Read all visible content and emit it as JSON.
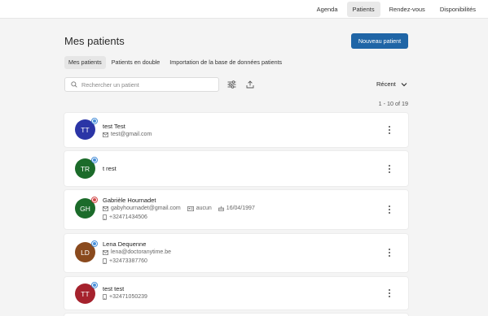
{
  "topnav": {
    "items": [
      {
        "label": "Agenda"
      },
      {
        "label": "Patients"
      },
      {
        "label": "Rendez-vous"
      },
      {
        "label": "Disponibilités"
      }
    ],
    "active": "Patients"
  },
  "page": {
    "title": "Mes patients",
    "new_button": "Nouveau patient"
  },
  "tabs": [
    {
      "label": "Mes patients",
      "active": true
    },
    {
      "label": "Patients en double",
      "active": false
    },
    {
      "label": "Importation de la base de données patients",
      "active": false
    }
  ],
  "search": {
    "placeholder": "Rechercher un patient",
    "value": ""
  },
  "toolbar": {
    "filter_icon": "sliders-icon",
    "export_icon": "upload-icon"
  },
  "sort": {
    "label": "Récent"
  },
  "pagination": {
    "text": "1 - 10 of 19"
  },
  "colors": {
    "primary": "#1f65a6",
    "badge_blue": "#4a90d9",
    "badge_red": "#d34a4a"
  },
  "patients": [
    {
      "initials": "TT",
      "name": "test Test",
      "color": "#2b35a6",
      "badge": "blue",
      "email": "test@gmail.com",
      "phone": "",
      "extra": "",
      "dob": ""
    },
    {
      "initials": "TR",
      "name": "t rest",
      "color": "#1b6b2a",
      "badge": "blue",
      "email": "",
      "phone": "",
      "extra": "",
      "dob": ""
    },
    {
      "initials": "GH",
      "name": "Gabrièle Hournadet",
      "color": "#1b6b2a",
      "badge": "red",
      "email": "gabyhournadet@gmail.com",
      "extra": "aucun",
      "dob": "16/04/1997",
      "phone": "+32471434506"
    },
    {
      "initials": "LD",
      "name": "Lena Dequenne",
      "color": "#8a4a1e",
      "badge": "blue",
      "email": "lena@doctoranytime.be",
      "phone": "+32473387760",
      "extra": "",
      "dob": ""
    },
    {
      "initials": "TT",
      "name": "test test",
      "color": "#a5222d",
      "badge": "blue",
      "email": "",
      "phone": "+32471050239",
      "extra": "",
      "dob": ""
    }
  ]
}
